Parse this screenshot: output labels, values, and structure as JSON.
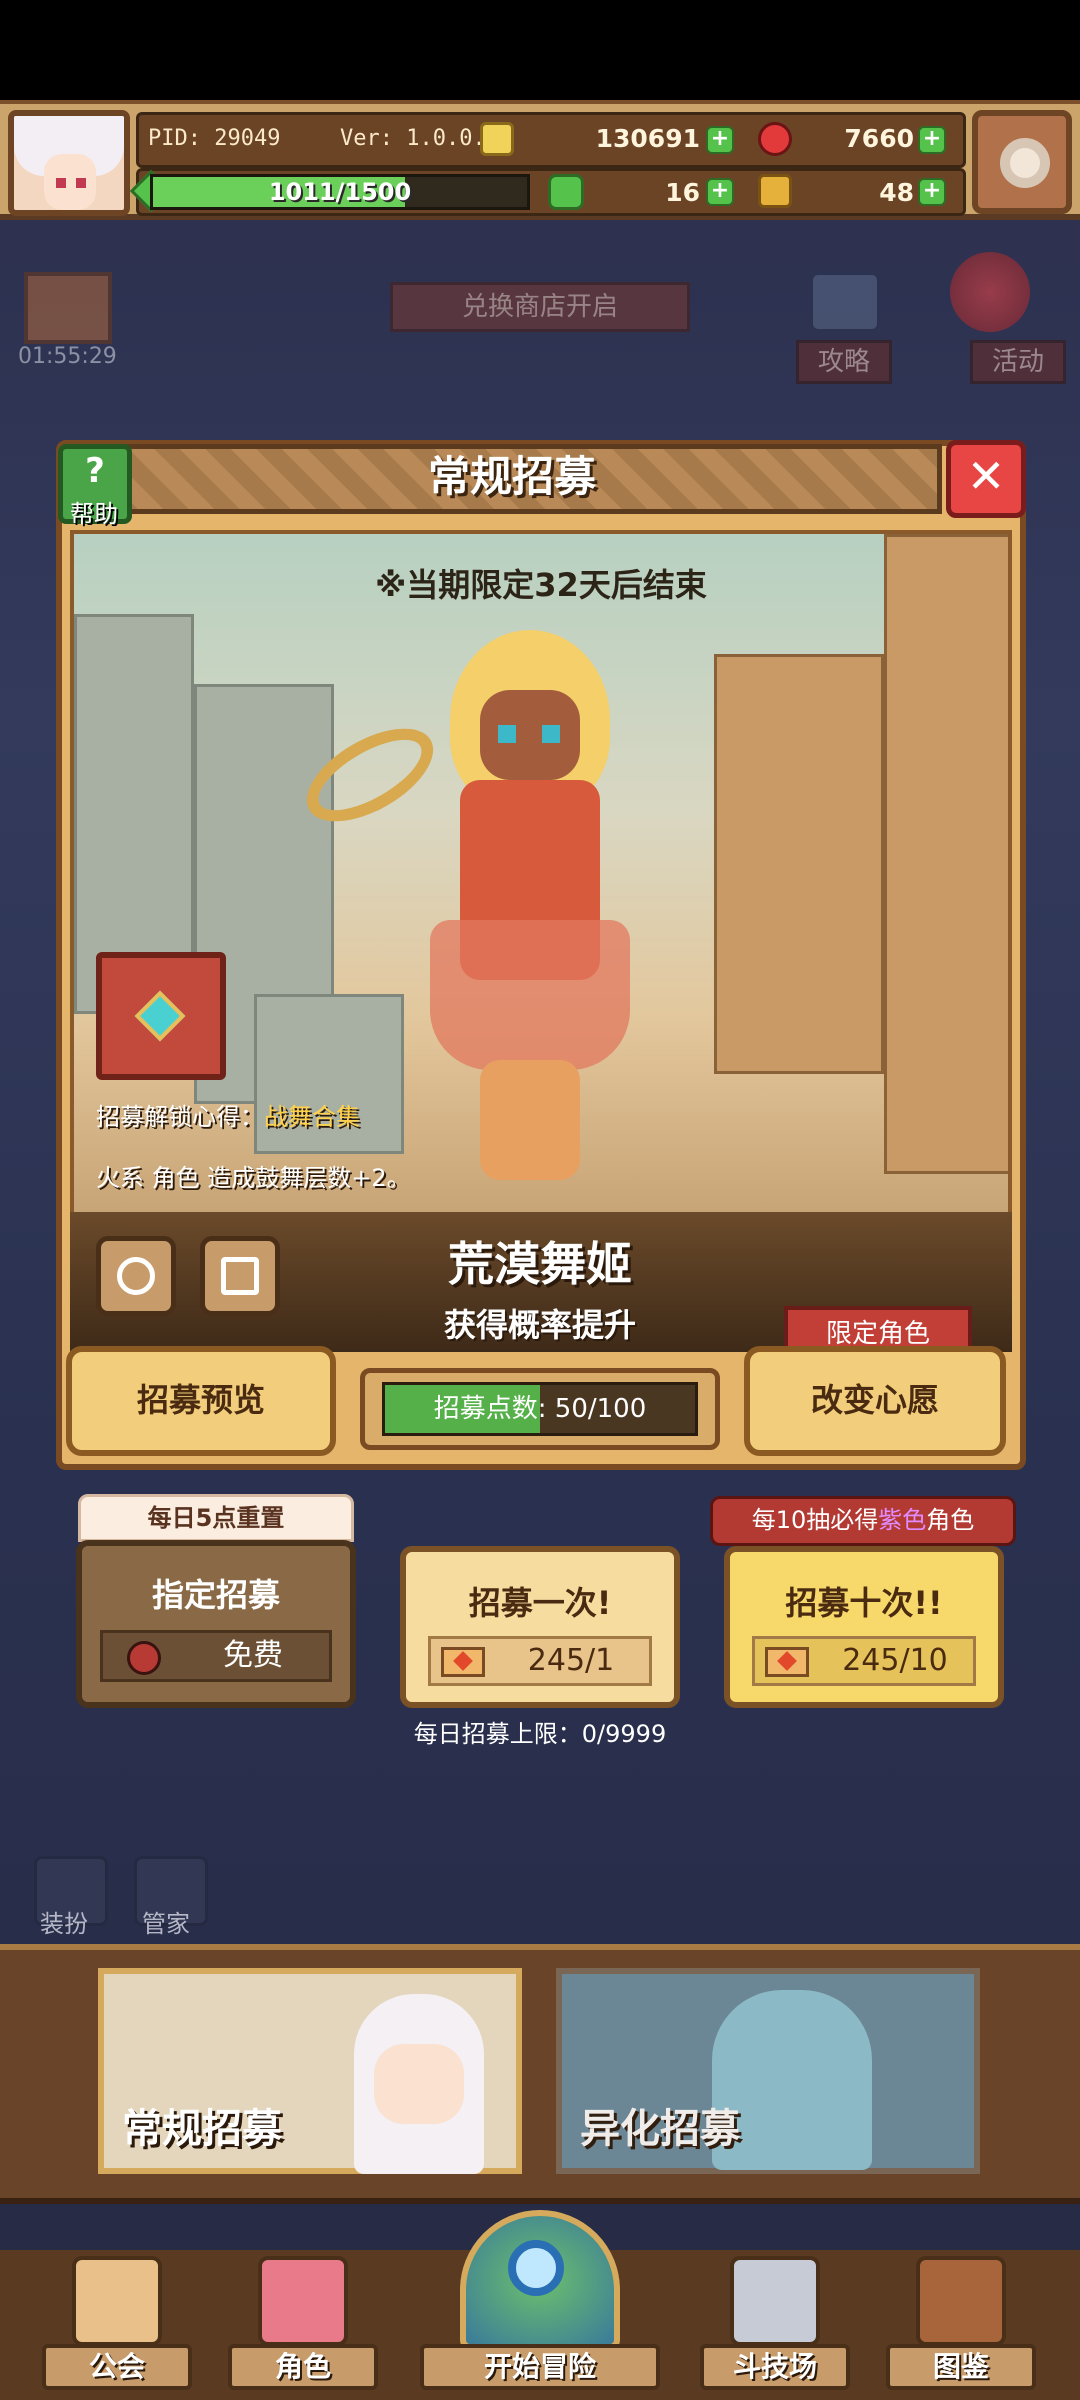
{
  "hud": {
    "pid": "PID: 29049",
    "version": "Ver: 1.0.0.4",
    "gold": "130691",
    "gems": "7660",
    "xp": "1011/1500",
    "xp_fraction": 0.674,
    "clover": "16",
    "tickets": "48"
  },
  "background": {
    "shop_banner": "兑换商店开启",
    "timer": "01:55:29",
    "guide_label": "攻略",
    "event_label": "活动",
    "outfit_label": "装扮",
    "butler_label": "管家"
  },
  "dialog": {
    "title": "常规招募",
    "help_label": "帮助",
    "notice": "※当期限定32天后结束",
    "unlock_prefix": "招募解锁心得：",
    "unlock_name": "战舞合集",
    "effect": "火系 角色 造成鼓舞层数+2。",
    "character_name": "荒漠舞姬",
    "rate_up": "获得概率提升",
    "preview_label": "招募预览",
    "points_label": "招募点数: 50/100",
    "points_fraction": 0.5,
    "limited_tag": "限定角色",
    "wish_label": "改变心愿"
  },
  "recruit": {
    "reset_tag": "每日5点重置",
    "designated_label": "指定招募",
    "designated_cost": "免费",
    "once_label": "招募一次!",
    "once_cost": "245/1",
    "ten_label": "招募十次!!",
    "ten_cost": "245/10",
    "guarantee_prefix": "每10抽必得",
    "guarantee_color": "紫色",
    "guarantee_suffix": "角色",
    "daily_limit": "每日招募上限：0/9999"
  },
  "cards": {
    "normal": "常规招募",
    "aberrant": "异化招募"
  },
  "nav": {
    "guild": "公会",
    "character": "角色",
    "start": "开始冒险",
    "arena": "斗技场",
    "codex": "图鉴"
  },
  "colors": {
    "accent_gold": "#f2cd7b",
    "accent_red": "#e84545",
    "progress_green": "#55b04a"
  }
}
